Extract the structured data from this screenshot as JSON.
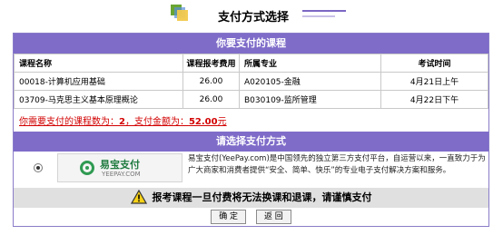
{
  "header": {
    "title": "支付方式选择"
  },
  "courses_section": {
    "title": "你要支付的课程",
    "columns": [
      "课程名称",
      "课程报考费用",
      "所属专业",
      "考试时间"
    ],
    "rows": [
      [
        "00018-计算机应用基础",
        "26.00",
        "A020105-金融",
        "4月21日上午"
      ],
      [
        "03709-马克思主义基本原理概论",
        "26.00",
        "B030109-监所管理",
        "4月22日下午"
      ]
    ],
    "summary_prefix": "你需要支付的课程数为：",
    "summary_count": "2",
    "summary_mid": "，支付金额为：",
    "summary_amount": "52.00",
    "summary_suffix": "元"
  },
  "payment_section": {
    "title": "请选择支付方式",
    "option": {
      "name": "易宝支付",
      "domain": "YEEPAY.COM",
      "description": "易宝支付(YeePay.com)是中国领先的独立第三方支付平台，自运营以来，一直致力于为广大商家和消费者提供“安全、简单、快乐”的专业电子支付解决方案和服务。"
    }
  },
  "warning": {
    "text": "报考课程一旦付费将无法换课和退课，请谨慎支付"
  },
  "buttons": {
    "confirm": "确 定",
    "back": "返 回"
  },
  "colors": {
    "band": "#7f6cc9",
    "summary": "#d20000",
    "yeepay": "#2f9a52"
  }
}
